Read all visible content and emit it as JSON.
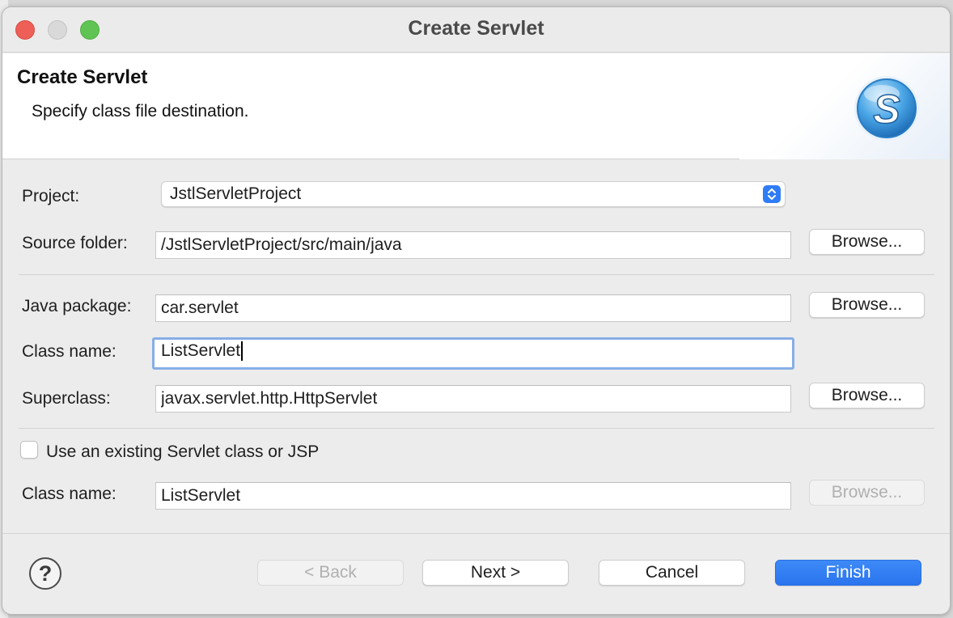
{
  "window": {
    "title": "Create Servlet"
  },
  "banner": {
    "title": "Create Servlet",
    "subtitle": "Specify class file destination.",
    "logo_icon": "servlet-s-logo-icon",
    "logo_letter": "S"
  },
  "form": {
    "project_label": "Project:",
    "project_value": "JstlServletProject",
    "source_folder_label": "Source folder:",
    "source_folder_value": "/JstlServletProject/src/main/java",
    "java_package_label": "Java package:",
    "java_package_value": "car.servlet",
    "class_name_label": "Class name:",
    "class_name_value": "ListServlet",
    "superclass_label": "Superclass:",
    "superclass_value": "javax.servlet.http.HttpServlet",
    "existing_checkbox_label": "Use an existing Servlet class or JSP",
    "existing_checked": false,
    "existing_class_label": "Class name:",
    "existing_class_value": "ListServlet",
    "browse_label": "Browse..."
  },
  "footer": {
    "help_icon": "question-mark-icon",
    "help_glyph": "?",
    "back_label": "< Back",
    "next_label": "Next >",
    "cancel_label": "Cancel",
    "finish_label": "Finish"
  },
  "colors": {
    "accent": "#2f7cf6",
    "focus_ring": "#86aee6",
    "close": "#ed5f57",
    "minimize": "#d9d9d9",
    "maximize": "#5fc454"
  }
}
